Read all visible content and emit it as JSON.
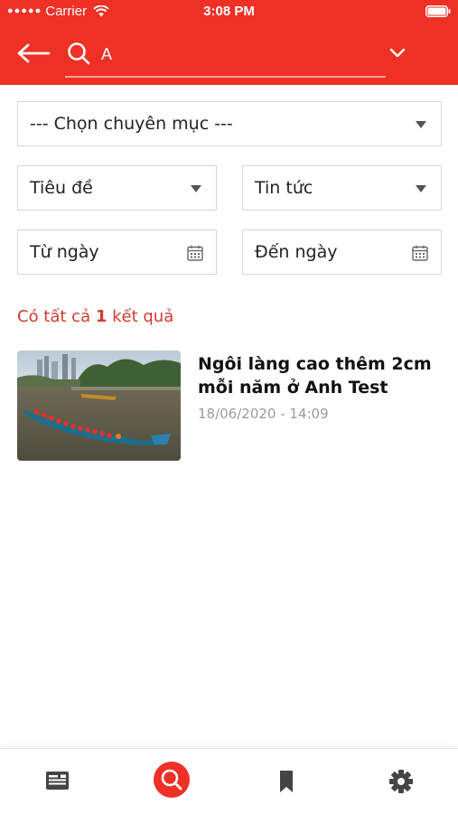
{
  "status_bar": {
    "carrier": "Carrier",
    "time": "3:08 PM"
  },
  "search": {
    "value": "A",
    "placeholder": ""
  },
  "filters": {
    "category": "--- Chọn chuyên mục ---",
    "field": "Tiêu đề",
    "type": "Tin tức",
    "from_date": "Từ ngày",
    "to_date": "Đến ngày"
  },
  "results": {
    "prefix": "Có tất cả ",
    "count": "1",
    "suffix": " kết quả",
    "items": [
      {
        "title": "Ngôi làng cao thêm 2cm mỗi năm ở Anh Test",
        "date": "18/06/2020 - 14:09",
        "image": "dragon-boat-race-photo"
      }
    ]
  },
  "tab_bar": {
    "tabs": [
      {
        "icon": "news-card-icon",
        "active": false
      },
      {
        "icon": "search-icon",
        "active": true
      },
      {
        "icon": "bookmark-icon",
        "active": false
      },
      {
        "icon": "gear-icon",
        "active": false
      }
    ]
  },
  "colors": {
    "brand": "#ee3124",
    "result_count": "#d43a2f",
    "date_text": "#9a9a9a",
    "tab_icon": "#444444"
  }
}
